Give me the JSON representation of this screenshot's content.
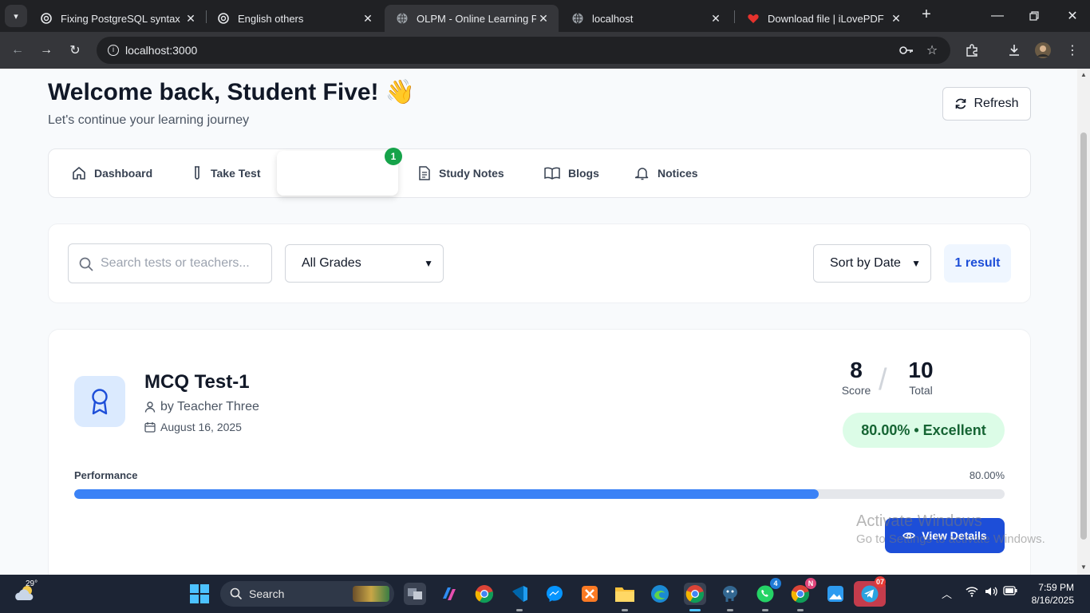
{
  "browser": {
    "tabs": [
      {
        "title": "Fixing PostgreSQL syntax err",
        "icon": "chatgpt-icon"
      },
      {
        "title": "English others",
        "icon": "chatgpt-icon"
      },
      {
        "title": "OLPM - Online Learning Plat",
        "icon": "globe-icon",
        "active": true
      },
      {
        "title": "localhost",
        "icon": "globe-icon"
      },
      {
        "title": "Download file | iLovePDF",
        "icon": "heart-icon"
      }
    ],
    "url": "localhost:3000"
  },
  "header": {
    "welcome": "Welcome back, Student Five! 👋",
    "subtitle": "Let's continue your learning journey",
    "refresh_label": "Refresh"
  },
  "nav": {
    "items": [
      {
        "label": "Dashboard",
        "icon": "home-icon"
      },
      {
        "label": "Take Test",
        "icon": "test-tube-icon"
      },
      {
        "label": "",
        "icon": ""
      },
      {
        "label": "Study Notes",
        "icon": "document-icon"
      },
      {
        "label": "Blogs",
        "icon": "book-open-icon"
      },
      {
        "label": "Notices",
        "icon": "bell-icon"
      }
    ],
    "badge": "1"
  },
  "filters": {
    "search_placeholder": "Search tests or teachers...",
    "grade_select": "All Grades",
    "sort_select": "Sort by Date",
    "result_count": "1 result"
  },
  "test": {
    "title": "MCQ Test-1",
    "teacher": "by Teacher Three",
    "date": "August 16, 2025",
    "score": "8",
    "score_label": "Score",
    "total": "10",
    "total_label": "Total",
    "grade": "80.00% • Excellent",
    "performance_label": "Performance",
    "performance_value": "80.00%",
    "performance_fraction": 0.8,
    "view_label": "View Details"
  },
  "watermark": {
    "line1": "Activate Windows",
    "line2": "Go to Settings to activate Windows."
  },
  "taskbar": {
    "temperature": "29°",
    "search_label": "Search",
    "time": "7:59 PM",
    "date": "8/16/2025",
    "badges": {
      "whatsapp": "4",
      "chrome_profile": "N",
      "telegram": "07"
    }
  },
  "colors": {
    "primary": "#1d4ed8",
    "progress": "#3b82f6",
    "success_bg": "#dcfce7",
    "success_text": "#166534",
    "badge": "#16a34a"
  }
}
